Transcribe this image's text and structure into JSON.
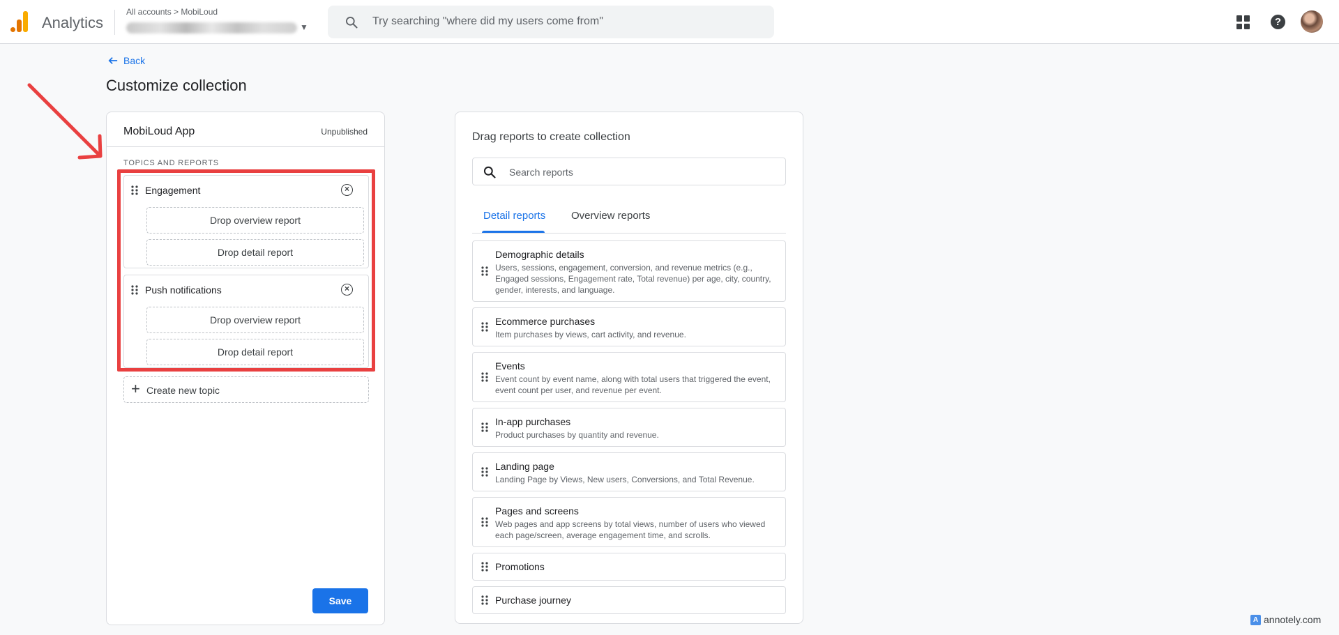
{
  "header": {
    "app_title": "Analytics",
    "breadcrumb": "All accounts > MobiLoud",
    "search_placeholder": "Try searching \"where did my users come from\""
  },
  "page": {
    "back_label": "Back",
    "title": "Customize collection"
  },
  "collection": {
    "name": "MobiLoud App",
    "status": "Unpublished",
    "section_label": "TOPICS AND REPORTS",
    "topics": [
      {
        "label": "Engagement",
        "overview_drop": "Drop overview report",
        "detail_drop": "Drop detail report"
      },
      {
        "label": "Push notifications",
        "overview_drop": "Drop overview report",
        "detail_drop": "Drop detail report"
      }
    ],
    "create_topic_label": "Create new topic",
    "save_label": "Save"
  },
  "library": {
    "title": "Drag reports to create collection",
    "search_placeholder": "Search reports",
    "tabs": [
      "Detail reports",
      "Overview reports"
    ],
    "reports": [
      {
        "name": "Demographic details",
        "desc": "Users, sessions, engagement, conversion, and revenue metrics (e.g., Engaged sessions, Engagement rate, Total revenue) per age, city, country, gender, interests, and language."
      },
      {
        "name": "Ecommerce purchases",
        "desc": "Item purchases by views, cart activity, and revenue."
      },
      {
        "name": "Events",
        "desc": "Event count by event name, along with total users that triggered the event, event count per user, and revenue per event."
      },
      {
        "name": "In-app purchases",
        "desc": "Product purchases by quantity and revenue."
      },
      {
        "name": "Landing page",
        "desc": "Landing Page by Views, New users, Conversions, and Total Revenue."
      },
      {
        "name": "Pages and screens",
        "desc": "Web pages and app screens by total views, number of users who viewed each page/screen, average engagement time, and scrolls."
      },
      {
        "name": "Promotions",
        "desc": ""
      },
      {
        "name": "Purchase journey",
        "desc": ""
      }
    ]
  },
  "watermark": "annotely.com",
  "colors": {
    "accent": "#1a73e8",
    "annotation": "#e94040"
  }
}
